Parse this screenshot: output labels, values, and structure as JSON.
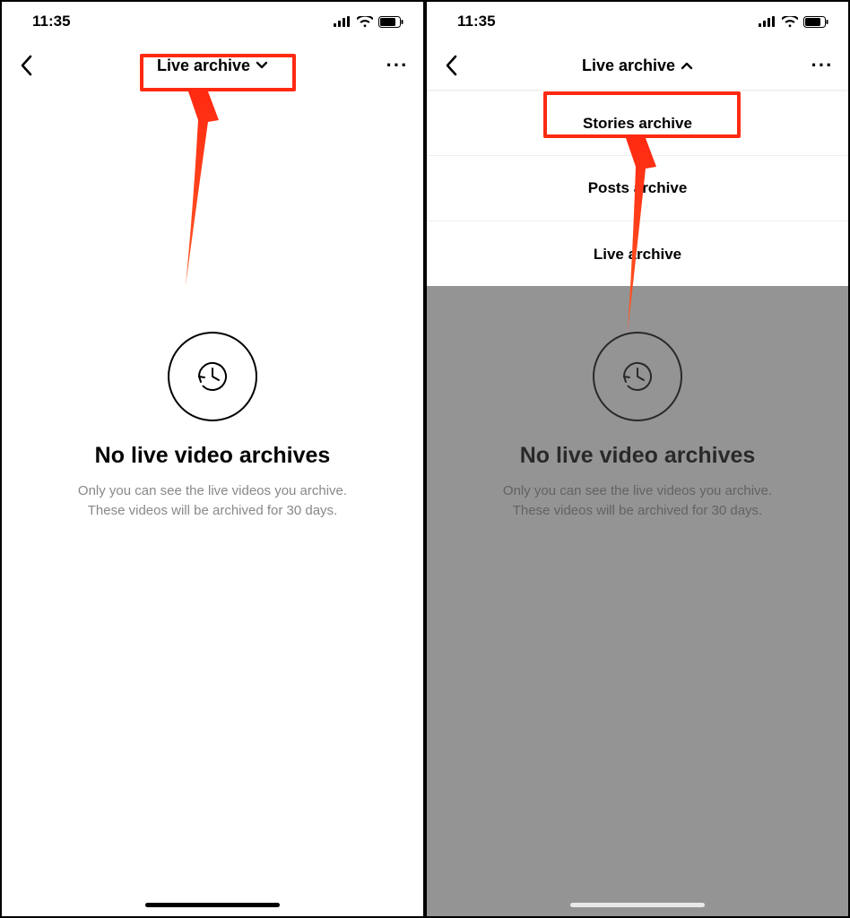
{
  "statusbar": {
    "time": "11:35"
  },
  "left": {
    "title": "Live archive",
    "empty": {
      "headline": "No live video archives",
      "line1": "Only you can see the live videos you archive.",
      "line2": "These videos will be archived for 30 days."
    }
  },
  "right": {
    "title": "Live archive",
    "dropdown": {
      "item1": "Stories archive",
      "item2": "Posts archive",
      "item3": "Live archive"
    },
    "empty": {
      "headline": "No live video archives",
      "line1": "Only you can see the live videos you archive.",
      "line2": "These videos will be archived for 30 days."
    }
  },
  "annotation": {
    "highlight_color": "#ff2a12"
  }
}
